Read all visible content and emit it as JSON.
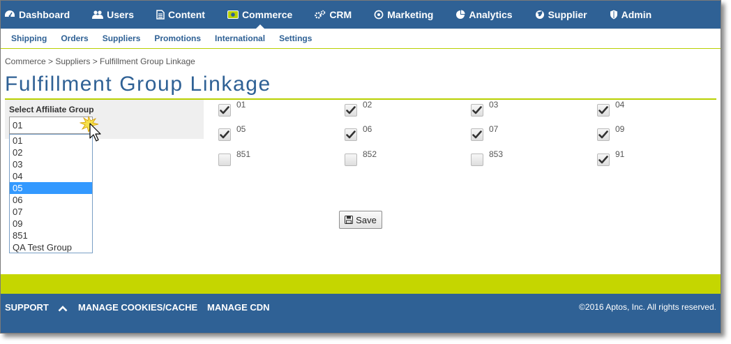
{
  "nav": {
    "items": [
      {
        "label": "Dashboard",
        "icon": "dashboard-icon"
      },
      {
        "label": "Users",
        "icon": "users-icon"
      },
      {
        "label": "Content",
        "icon": "document-icon"
      },
      {
        "label": "Commerce",
        "icon": "money-icon",
        "active": true
      },
      {
        "label": "CRM",
        "icon": "gears-icon"
      },
      {
        "label": "Marketing",
        "icon": "target-icon"
      },
      {
        "label": "Analytics",
        "icon": "pie-chart-icon"
      },
      {
        "label": "Supplier",
        "icon": "globe-icon"
      },
      {
        "label": "Admin",
        "icon": "shield-icon"
      }
    ]
  },
  "subnav": {
    "items": [
      "Shipping",
      "Orders",
      "Suppliers",
      "Promotions",
      "International",
      "Settings"
    ]
  },
  "breadcrumb": "Commerce > Suppliers > Fulfillment Group Linkage",
  "page_title": "Fulfillment Group Linkage",
  "affiliate": {
    "label": "Select Affiliate Group",
    "selected": "01",
    "options": [
      "01",
      "02",
      "03",
      "04",
      "05",
      "06",
      "07",
      "09",
      "851",
      "QA Test Group"
    ],
    "highlighted": "05"
  },
  "groups": [
    {
      "label": "01",
      "checked": true
    },
    {
      "label": "02",
      "checked": true
    },
    {
      "label": "03",
      "checked": true
    },
    {
      "label": "04",
      "checked": true
    },
    {
      "label": "05",
      "checked": true
    },
    {
      "label": "06",
      "checked": true
    },
    {
      "label": "07",
      "checked": true
    },
    {
      "label": "09",
      "checked": true
    },
    {
      "label": "851",
      "checked": false
    },
    {
      "label": "852",
      "checked": false
    },
    {
      "label": "853",
      "checked": false
    },
    {
      "label": "91",
      "checked": true
    }
  ],
  "save_label": "Save",
  "footer": {
    "support": "SUPPORT",
    "cookies": "MANAGE COOKIES/CACHE",
    "cdn": "MANAGE CDN",
    "copyright": "©2016 Aptos, Inc. All rights reserved."
  },
  "colors": {
    "primary": "#2f6195",
    "accent": "#b8d000",
    "highlight": "#3399ff"
  }
}
